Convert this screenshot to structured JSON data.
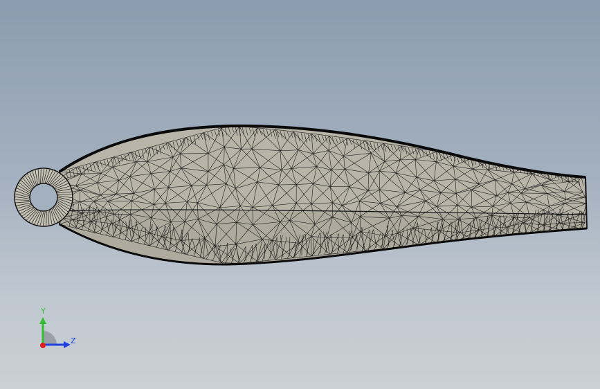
{
  "viewport": {
    "background_top": "#8c9cb0",
    "background_bottom": "#cbd0d4"
  },
  "model": {
    "part": "propeller-blade",
    "display_mode": "mesh",
    "surface_color": "#b8b5a8",
    "edge_color": "#111111"
  },
  "triad": {
    "y_label": "Y",
    "z_label": "Z",
    "y_color": "#30c030",
    "z_color": "#2040e0",
    "x_color": "#e02020"
  }
}
